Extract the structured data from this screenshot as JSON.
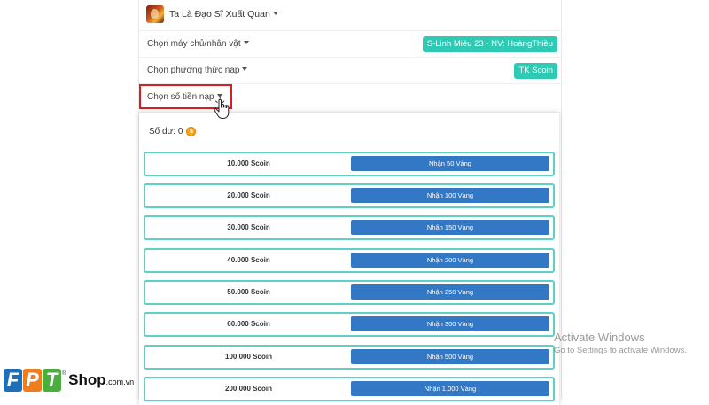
{
  "header": {
    "game_title": "Ta Là Đạo Sĩ Xuất Quan"
  },
  "form": {
    "server_label": "Chọn máy chủ/nhân vật",
    "server_value": "S-Linh Miêu 23 - NV: HoàngThiều",
    "payment_label": "Chọn phương thức nạp",
    "payment_value": "TK Scoin",
    "amount_label": "Chọn số tiền nạp"
  },
  "dropdown": {
    "balance_label": "Số dư: 0",
    "options": [
      {
        "amount": "10.000 Scoin",
        "reward": "Nhận 50 Vàng"
      },
      {
        "amount": "20.000 Scoin",
        "reward": "Nhận 100 Vàng"
      },
      {
        "amount": "30.000 Scoin",
        "reward": "Nhận 150 Vàng"
      },
      {
        "amount": "40.000 Scoin",
        "reward": "Nhận 200 Vàng"
      },
      {
        "amount": "50.000 Scoin",
        "reward": "Nhận 250 Vàng"
      },
      {
        "amount": "60.000 Scoin",
        "reward": "Nhận 300 Vàng"
      },
      {
        "amount": "100.000 Scoin",
        "reward": "Nhận 500 Vàng"
      },
      {
        "amount": "200.000 Scoin",
        "reward": "Nhận 1.000 Vàng"
      }
    ]
  },
  "watermark": {
    "title": "Activate Windows",
    "subtitle": "Go to Settings to activate Windows."
  },
  "logo": {
    "letters": [
      "F",
      "P",
      "T"
    ],
    "shop": "Shop",
    "domain": ".com.vn",
    "reg": "®"
  },
  "colors": {
    "teal": "#2fcab3",
    "button_blue": "#3378c4",
    "highlight_red": "#d32027",
    "option_border": "#5fd0c4"
  }
}
